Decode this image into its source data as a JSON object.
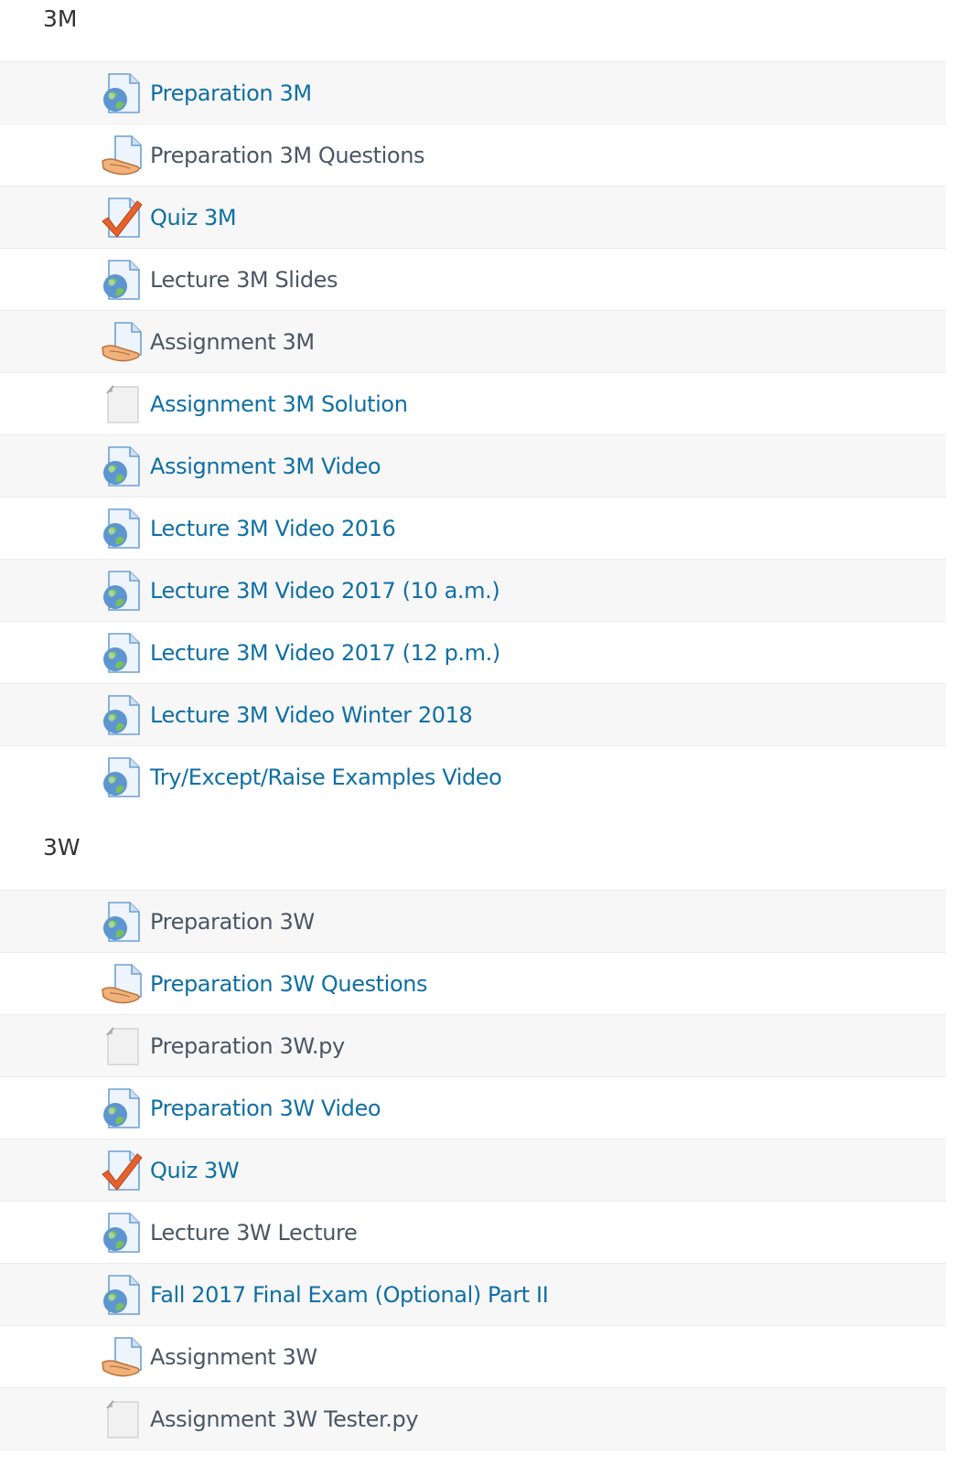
{
  "sections": [
    {
      "title": "3M",
      "items": [
        {
          "label": "Preparation 3M",
          "icon": "url-icon",
          "dim": false
        },
        {
          "label": "Preparation 3M Questions",
          "icon": "assignment-icon",
          "dim": true
        },
        {
          "label": "Quiz 3M",
          "icon": "quiz-icon",
          "dim": false
        },
        {
          "label": "Lecture 3M Slides",
          "icon": "url-icon",
          "dim": true
        },
        {
          "label": "Assignment 3M",
          "icon": "assignment-icon",
          "dim": true
        },
        {
          "label": "Assignment 3M Solution",
          "icon": "file-icon",
          "dim": false
        },
        {
          "label": "Assignment 3M Video",
          "icon": "url-icon",
          "dim": false
        },
        {
          "label": "Lecture 3M Video 2016",
          "icon": "url-icon",
          "dim": false
        },
        {
          "label": "Lecture 3M Video 2017 (10 a.m.)",
          "icon": "url-icon",
          "dim": false
        },
        {
          "label": "Lecture 3M Video 2017 (12 p.m.)",
          "icon": "url-icon",
          "dim": false
        },
        {
          "label": "Lecture 3M Video Winter 2018",
          "icon": "url-icon",
          "dim": false
        },
        {
          "label": "Try/Except/Raise Examples Video",
          "icon": "url-icon",
          "dim": false
        }
      ]
    },
    {
      "title": "3W",
      "items": [
        {
          "label": "Preparation 3W",
          "icon": "url-icon",
          "dim": true
        },
        {
          "label": "Preparation 3W Questions",
          "icon": "assignment-icon",
          "dim": false
        },
        {
          "label": "Preparation 3W.py",
          "icon": "file-icon",
          "dim": true
        },
        {
          "label": "Preparation 3W Video",
          "icon": "url-icon",
          "dim": false
        },
        {
          "label": "Quiz 3W",
          "icon": "quiz-icon",
          "dim": false
        },
        {
          "label": "Lecture 3W Lecture",
          "icon": "url-icon",
          "dim": true
        },
        {
          "label": "Fall 2017 Final Exam (Optional) Part II",
          "icon": "url-icon",
          "dim": false
        },
        {
          "label": "Assignment 3W",
          "icon": "assignment-icon",
          "dim": true
        },
        {
          "label": "Assignment 3W Tester.py",
          "icon": "file-icon",
          "dim": true
        }
      ]
    }
  ],
  "colors": {
    "link": "#0f6fa3",
    "link_dim": "#4a5663",
    "row_shade": "#f7f7f7",
    "divider": "#ececec"
  }
}
